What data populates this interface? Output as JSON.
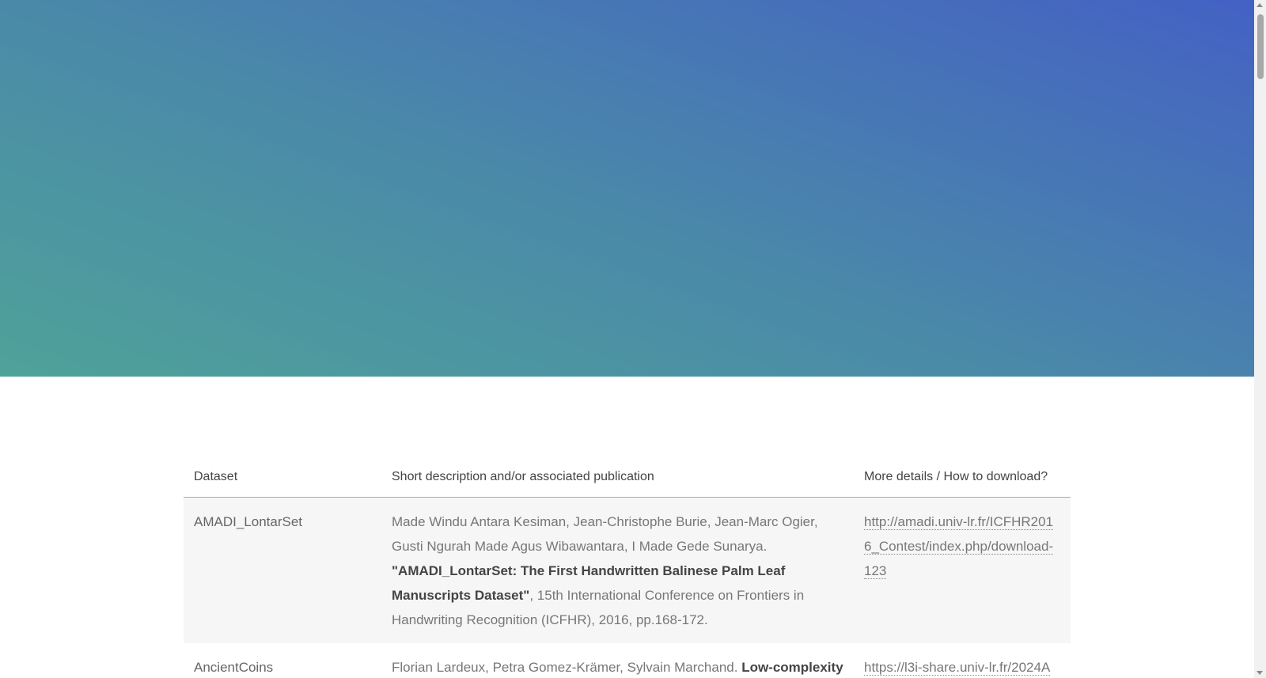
{
  "table": {
    "headers": {
      "dataset": "Dataset",
      "description": "Short description and/or associated publication",
      "details": "More details / How to download?"
    },
    "rows": [
      {
        "dataset": "AMADI_LontarSet",
        "authors": "Made Windu Antara Kesiman, Jean-Christophe Burie, Jean-Marc Ogier, Gusti Ngurah Made Agus Wibawantara, I Made Gede Sunarya. ",
        "title": "\"AMADI_LontarSet: The First Handwritten Balinese Palm Leaf Manuscripts Dataset\"",
        "venue": ", 15th International Conference on Frontiers in Handwriting Recognition (ICFHR), 2016, pp.168-172.",
        "link": "http://amadi.univ-lr.fr/ICFHR2016_Contest/index.php/download-123"
      },
      {
        "dataset": "AncientCoins",
        "authors": "Florian Lardeux, Petra Gomez-Krämer, Sylvain Marchand. ",
        "title": "Low-complexity",
        "venue": "",
        "link": "https://l3i-share.univ-lr.fr/2024A"
      }
    ]
  }
}
